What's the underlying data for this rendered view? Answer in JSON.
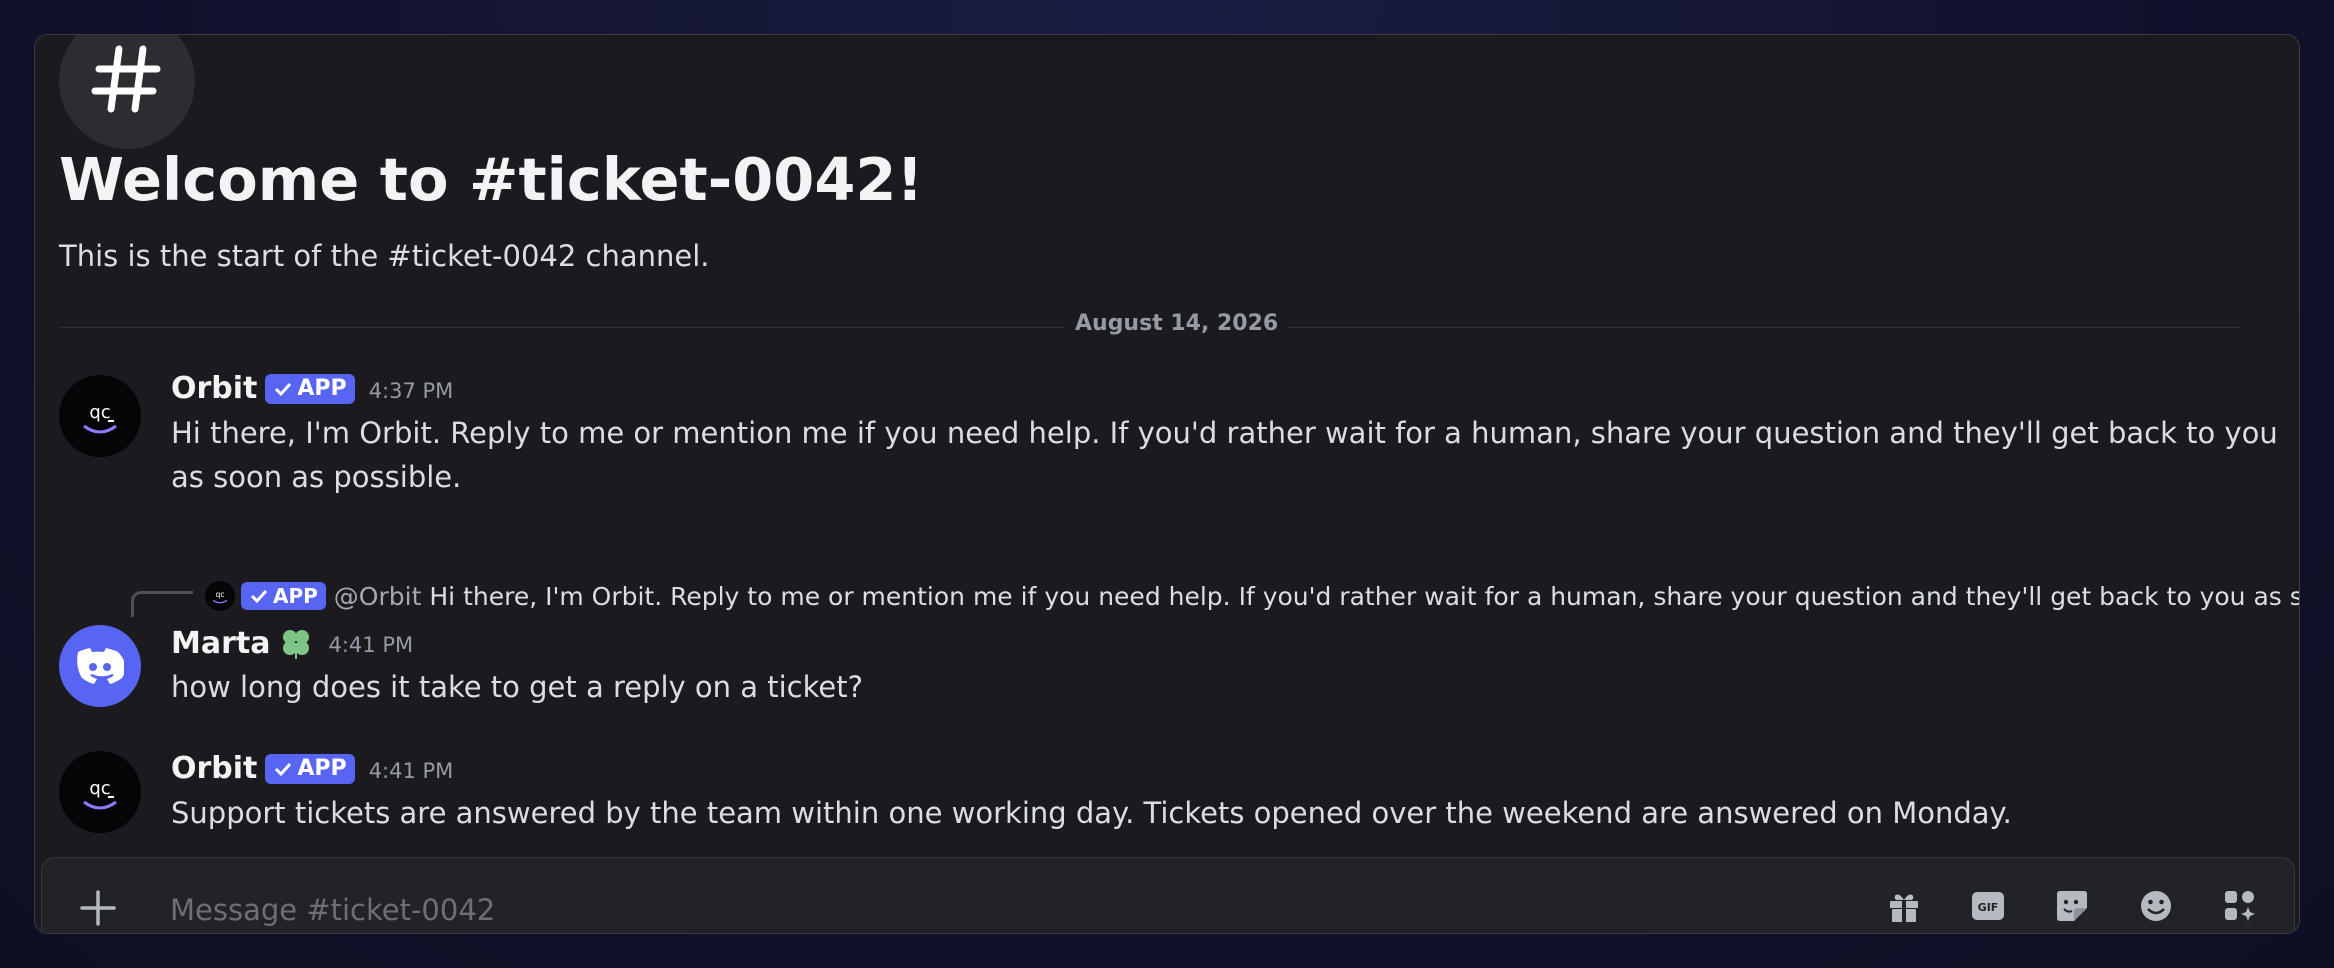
{
  "channel": {
    "welcome_title": "Welcome to #ticket-0042!",
    "welcome_subtitle": "This is the start of the #ticket-0042 channel.",
    "date_divider": "August 14, 2026"
  },
  "badge_label": "APP",
  "messages": [
    {
      "author": "Orbit",
      "bot": true,
      "time": "4:37 PM",
      "text": "Hi there, I'm Orbit. Reply to me or mention me if you need help. If you'd rather wait for a human, share your question and they'll get back to you as soon as possible."
    },
    {
      "author": "Marta",
      "bot": false,
      "time": "4:41 PM",
      "text": "how long does it take to get a reply on a ticket?",
      "reply_to": {
        "mention": "@Orbit",
        "preview": "Hi there, I'm Orbit. Reply to me or mention me if you need help. If you'd rather wait for a human, share your question and they'll get back to you as soon ..."
      }
    },
    {
      "author": "Orbit",
      "bot": true,
      "time": "4:41 PM",
      "text": "Support tickets are answered by the team within one working day. Tickets opened over the weekend are answered on Monday."
    }
  ],
  "composer": {
    "placeholder": "Message #ticket-0042",
    "icons": [
      "gift-icon",
      "gif-icon",
      "sticker-icon",
      "emoji-icon",
      "apps-icon"
    ]
  },
  "colors": {
    "accent": "#5865f2",
    "background": "#1b1b1f",
    "text": "#dbdee1",
    "muted": "#949ba4",
    "role_icon": "#7ec587"
  }
}
